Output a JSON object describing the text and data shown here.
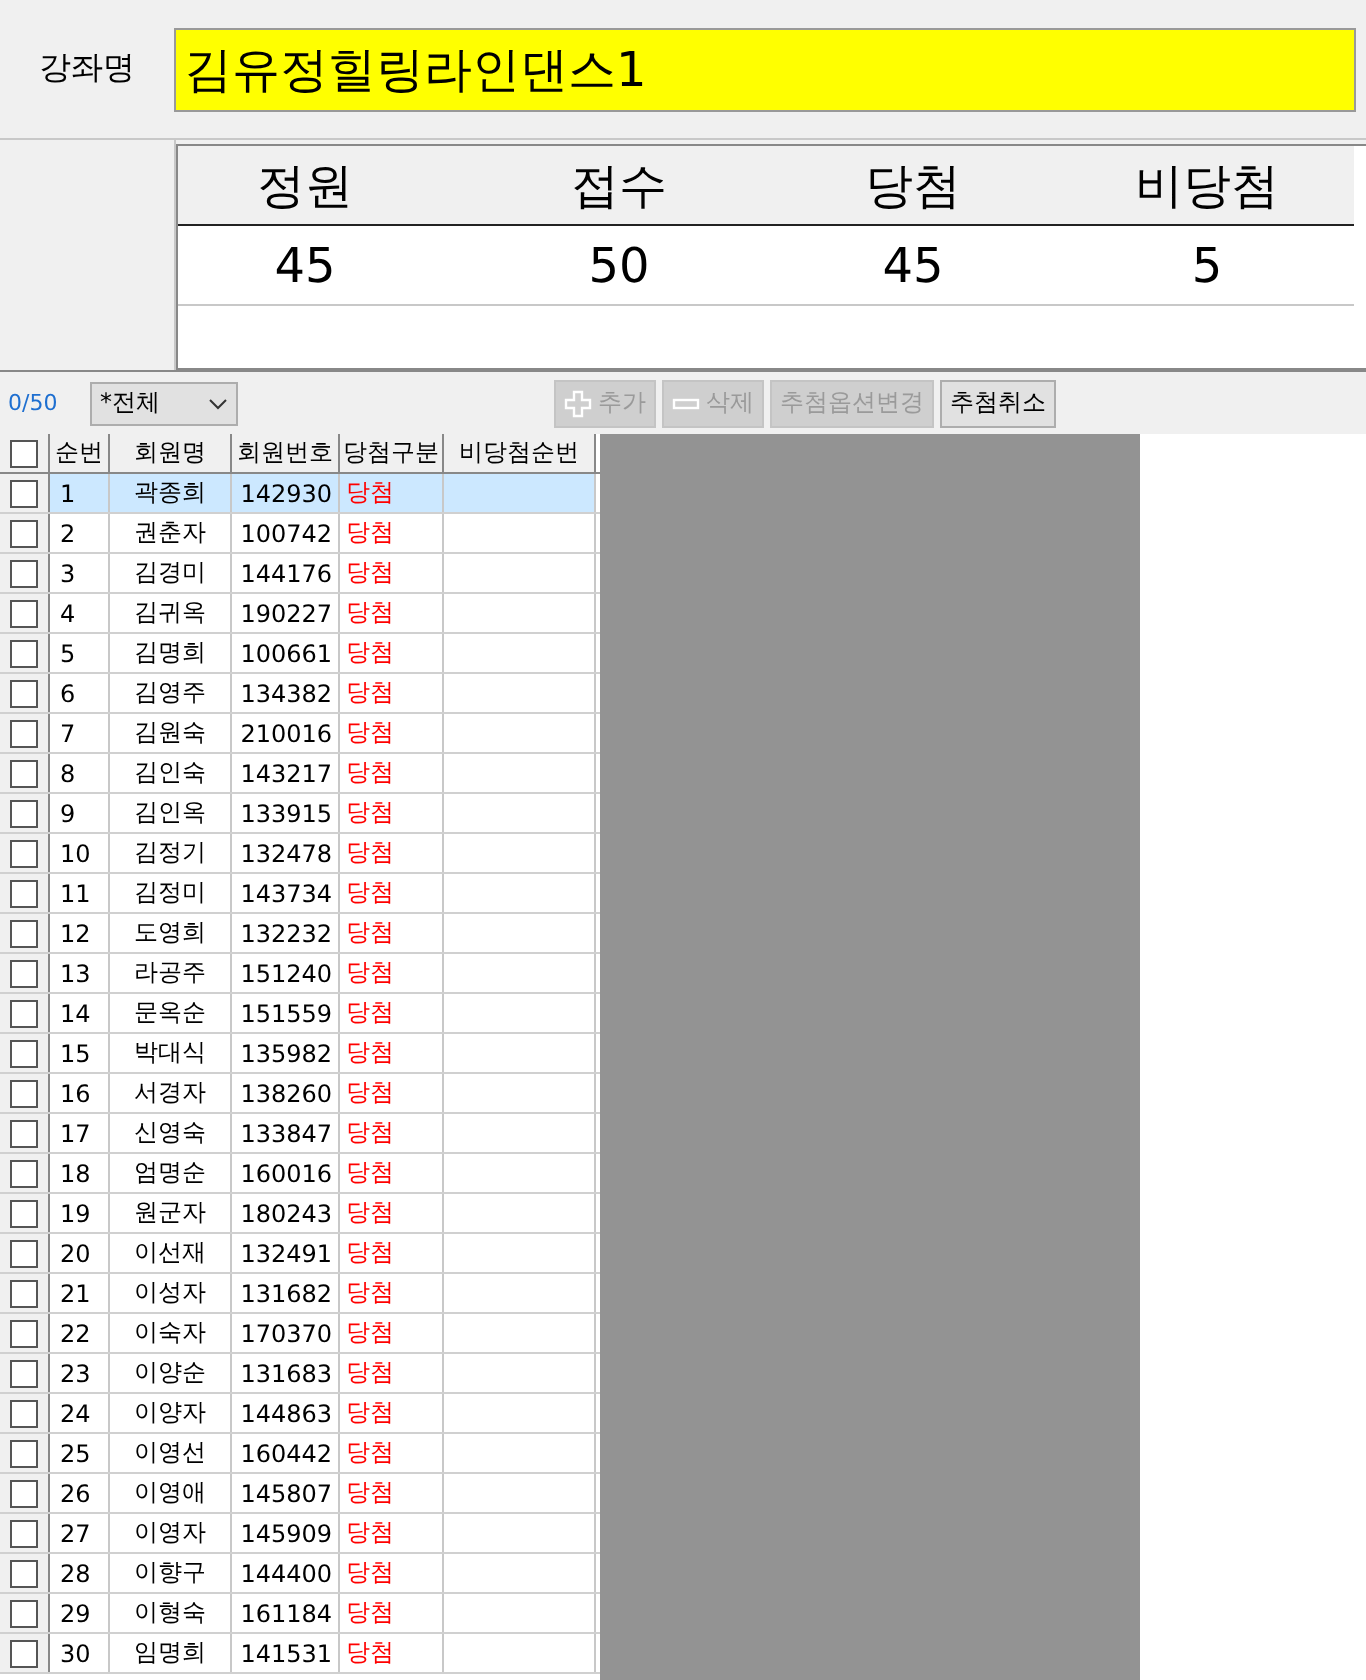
{
  "course": {
    "label": "강좌명",
    "value": "김유정힐링라인댄스1"
  },
  "summary": {
    "columns": [
      "정원",
      "접수",
      "당첨",
      "비당첨"
    ],
    "values": [
      "45",
      "50",
      "45",
      "5"
    ]
  },
  "toolbar": {
    "count": "0/50",
    "filter": "*전체",
    "buttons": [
      {
        "label": "추가",
        "kind": "add",
        "disabled": true
      },
      {
        "label": "삭제",
        "kind": "delete",
        "disabled": true
      },
      {
        "label": "추첨옵션변경",
        "kind": "text",
        "disabled": true
      },
      {
        "label": "추첨취소",
        "kind": "text",
        "disabled": false
      }
    ]
  },
  "grid": {
    "all_checked": false,
    "columns": [
      "순번",
      "회원명",
      "회원번호",
      "당첨구분",
      "비당첨순번"
    ],
    "rows": [
      {
        "no": "1",
        "name": "곽종희",
        "id": "142930",
        "result": "당첨",
        "checked": false,
        "selected": true
      },
      {
        "no": "2",
        "name": "권춘자",
        "id": "100742",
        "result": "당첨",
        "checked": false,
        "selected": false
      },
      {
        "no": "3",
        "name": "김경미",
        "id": "144176",
        "result": "당첨",
        "checked": false,
        "selected": false
      },
      {
        "no": "4",
        "name": "김귀옥",
        "id": "190227",
        "result": "당첨",
        "checked": false,
        "selected": false
      },
      {
        "no": "5",
        "name": "김명희",
        "id": "100661",
        "result": "당첨",
        "checked": false,
        "selected": false
      },
      {
        "no": "6",
        "name": "김영주",
        "id": "134382",
        "result": "당첨",
        "checked": false,
        "selected": false
      },
      {
        "no": "7",
        "name": "김원숙",
        "id": "210016",
        "result": "당첨",
        "checked": false,
        "selected": false
      },
      {
        "no": "8",
        "name": "김인숙",
        "id": "143217",
        "result": "당첨",
        "checked": false,
        "selected": false
      },
      {
        "no": "9",
        "name": "김인옥",
        "id": "133915",
        "result": "당첨",
        "checked": false,
        "selected": false
      },
      {
        "no": "10",
        "name": "김정기",
        "id": "132478",
        "result": "당첨",
        "checked": false,
        "selected": false
      },
      {
        "no": "11",
        "name": "김정미",
        "id": "143734",
        "result": "당첨",
        "checked": false,
        "selected": false
      },
      {
        "no": "12",
        "name": "도영희",
        "id": "132232",
        "result": "당첨",
        "checked": false,
        "selected": false
      },
      {
        "no": "13",
        "name": "라공주",
        "id": "151240",
        "result": "당첨",
        "checked": false,
        "selected": false
      },
      {
        "no": "14",
        "name": "문옥순",
        "id": "151559",
        "result": "당첨",
        "checked": false,
        "selected": false
      },
      {
        "no": "15",
        "name": "박대식",
        "id": "135982",
        "result": "당첨",
        "checked": false,
        "selected": false
      },
      {
        "no": "16",
        "name": "서경자",
        "id": "138260",
        "result": "당첨",
        "checked": false,
        "selected": false
      },
      {
        "no": "17",
        "name": "신영숙",
        "id": "133847",
        "result": "당첨",
        "checked": false,
        "selected": false
      },
      {
        "no": "18",
        "name": "엄명순",
        "id": "160016",
        "result": "당첨",
        "checked": false,
        "selected": false
      },
      {
        "no": "19",
        "name": "원군자",
        "id": "180243",
        "result": "당첨",
        "checked": false,
        "selected": false
      },
      {
        "no": "20",
        "name": "이선재",
        "id": "132491",
        "result": "당첨",
        "checked": false,
        "selected": false
      },
      {
        "no": "21",
        "name": "이성자",
        "id": "131682",
        "result": "당첨",
        "checked": false,
        "selected": false
      },
      {
        "no": "22",
        "name": "이숙자",
        "id": "170370",
        "result": "당첨",
        "checked": false,
        "selected": false
      },
      {
        "no": "23",
        "name": "이양순",
        "id": "131683",
        "result": "당첨",
        "checked": false,
        "selected": false
      },
      {
        "no": "24",
        "name": "이양자",
        "id": "144863",
        "result": "당첨",
        "checked": false,
        "selected": false
      },
      {
        "no": "25",
        "name": "이영선",
        "id": "160442",
        "result": "당첨",
        "checked": false,
        "selected": false
      },
      {
        "no": "26",
        "name": "이영애",
        "id": "145807",
        "result": "당첨",
        "checked": false,
        "selected": false
      },
      {
        "no": "27",
        "name": "이영자",
        "id": "145909",
        "result": "당첨",
        "checked": false,
        "selected": false
      },
      {
        "no": "28",
        "name": "이향구",
        "id": "144400",
        "result": "당첨",
        "checked": false,
        "selected": false
      },
      {
        "no": "29",
        "name": "이형숙",
        "id": "161184",
        "result": "당첨",
        "checked": false,
        "selected": false
      },
      {
        "no": "30",
        "name": "임명희",
        "id": "141531",
        "result": "당첨",
        "checked": false,
        "selected": false
      }
    ]
  }
}
